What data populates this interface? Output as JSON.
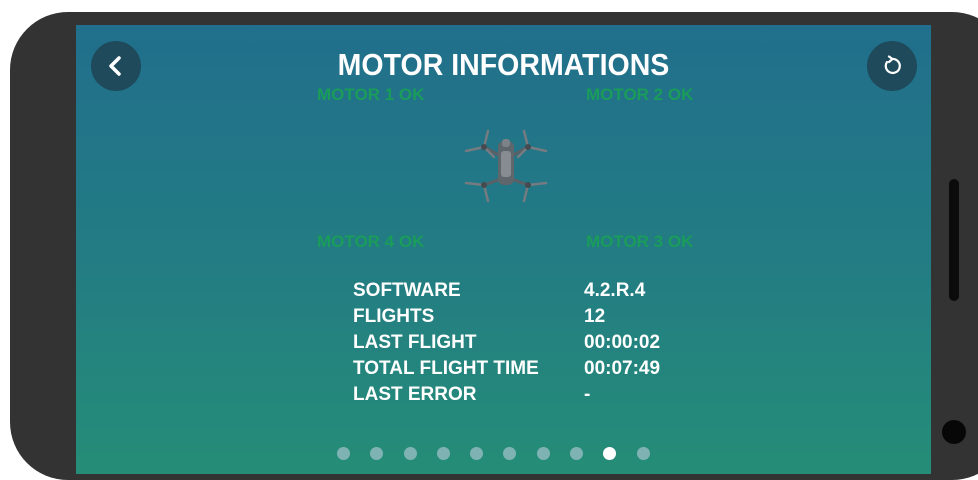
{
  "header": {
    "title": "MOTOR INFORMATIONS",
    "back_icon": "chevron-left-icon",
    "refresh_icon": "refresh-icon"
  },
  "motors": {
    "motor1": "MOTOR 1 OK",
    "motor2": "MOTOR 2 OK",
    "motor3": "MOTOR 3 OK",
    "motor4": "MOTOR 4 OK",
    "status_color": "#1a9c5a"
  },
  "info": [
    {
      "label": "SOFTWARE",
      "value": "4.2.R.4"
    },
    {
      "label": "FLIGHTS",
      "value": "12"
    },
    {
      "label": "LAST FLIGHT",
      "value": "00:00:02"
    },
    {
      "label": "TOTAL FLIGHT TIME",
      "value": "00:07:49"
    },
    {
      "label": "LAST ERROR",
      "value": "-"
    }
  ],
  "pagination": {
    "total": 10,
    "active_index": 8
  },
  "colors": {
    "background_top": "#216f8c",
    "background_bottom": "#258d77",
    "button_bg": "#1f4a5c"
  }
}
